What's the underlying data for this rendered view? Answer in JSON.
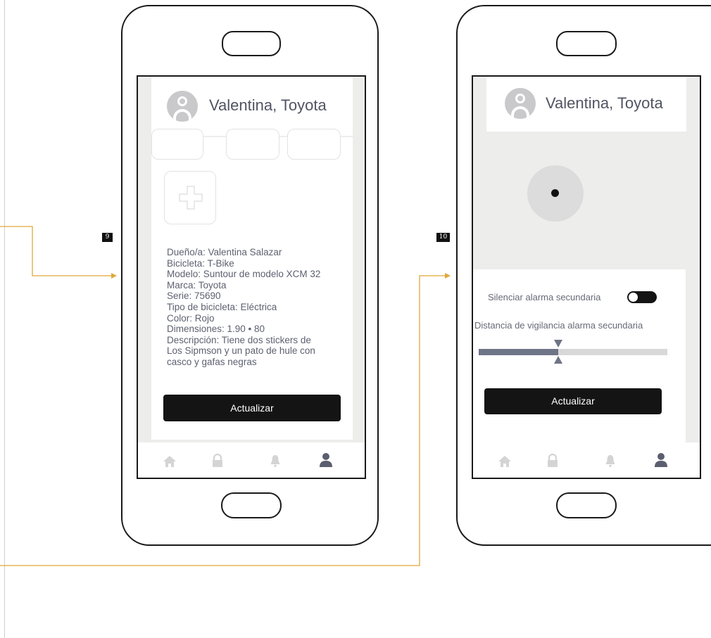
{
  "steps": {
    "first": "9",
    "second": "10"
  },
  "colors": {
    "connector": "#e0a83a",
    "primary_button": "#141414",
    "muted_icon": "#d4d4d4",
    "active_icon": "#5a5e6e"
  },
  "screen_profile": {
    "header": {
      "name": "Valentina, Toyota",
      "avatar_icon": "user-avatar-icon"
    },
    "add_photo_icon": "plus-icon",
    "details": [
      "Dueño/a: Valentina Salazar",
      "Bicicleta: T-Bike",
      "Modelo: Suntour de modelo XCM 32",
      "Marca: Toyota",
      "Serie: 75690",
      "Tipo de bicicleta: Eléctrica",
      "Color: Rojo",
      "Dimensiones: 1.90 • 80",
      "Descripción: Tiene dos stickers de",
      "Los Sipmson y un pato de hule con",
      "casco y gafas negras"
    ],
    "update_button": "Actualizar"
  },
  "screen_alarm": {
    "header": {
      "name": "Valentina, Toyota",
      "avatar_icon": "user-avatar-icon"
    },
    "silence_label": "Silenciar alarma secundaria",
    "silence_toggle_on": false,
    "distance_label": "Distancia de vigilancia alarma secundaria",
    "distance_level": 0.42,
    "update_button": "Actualizar"
  },
  "bottom_nav": [
    {
      "icon": "home-icon",
      "active": false
    },
    {
      "icon": "lock-icon",
      "active": false
    },
    {
      "icon": "bell-icon",
      "active": false
    },
    {
      "icon": "user-icon",
      "active": true
    }
  ]
}
